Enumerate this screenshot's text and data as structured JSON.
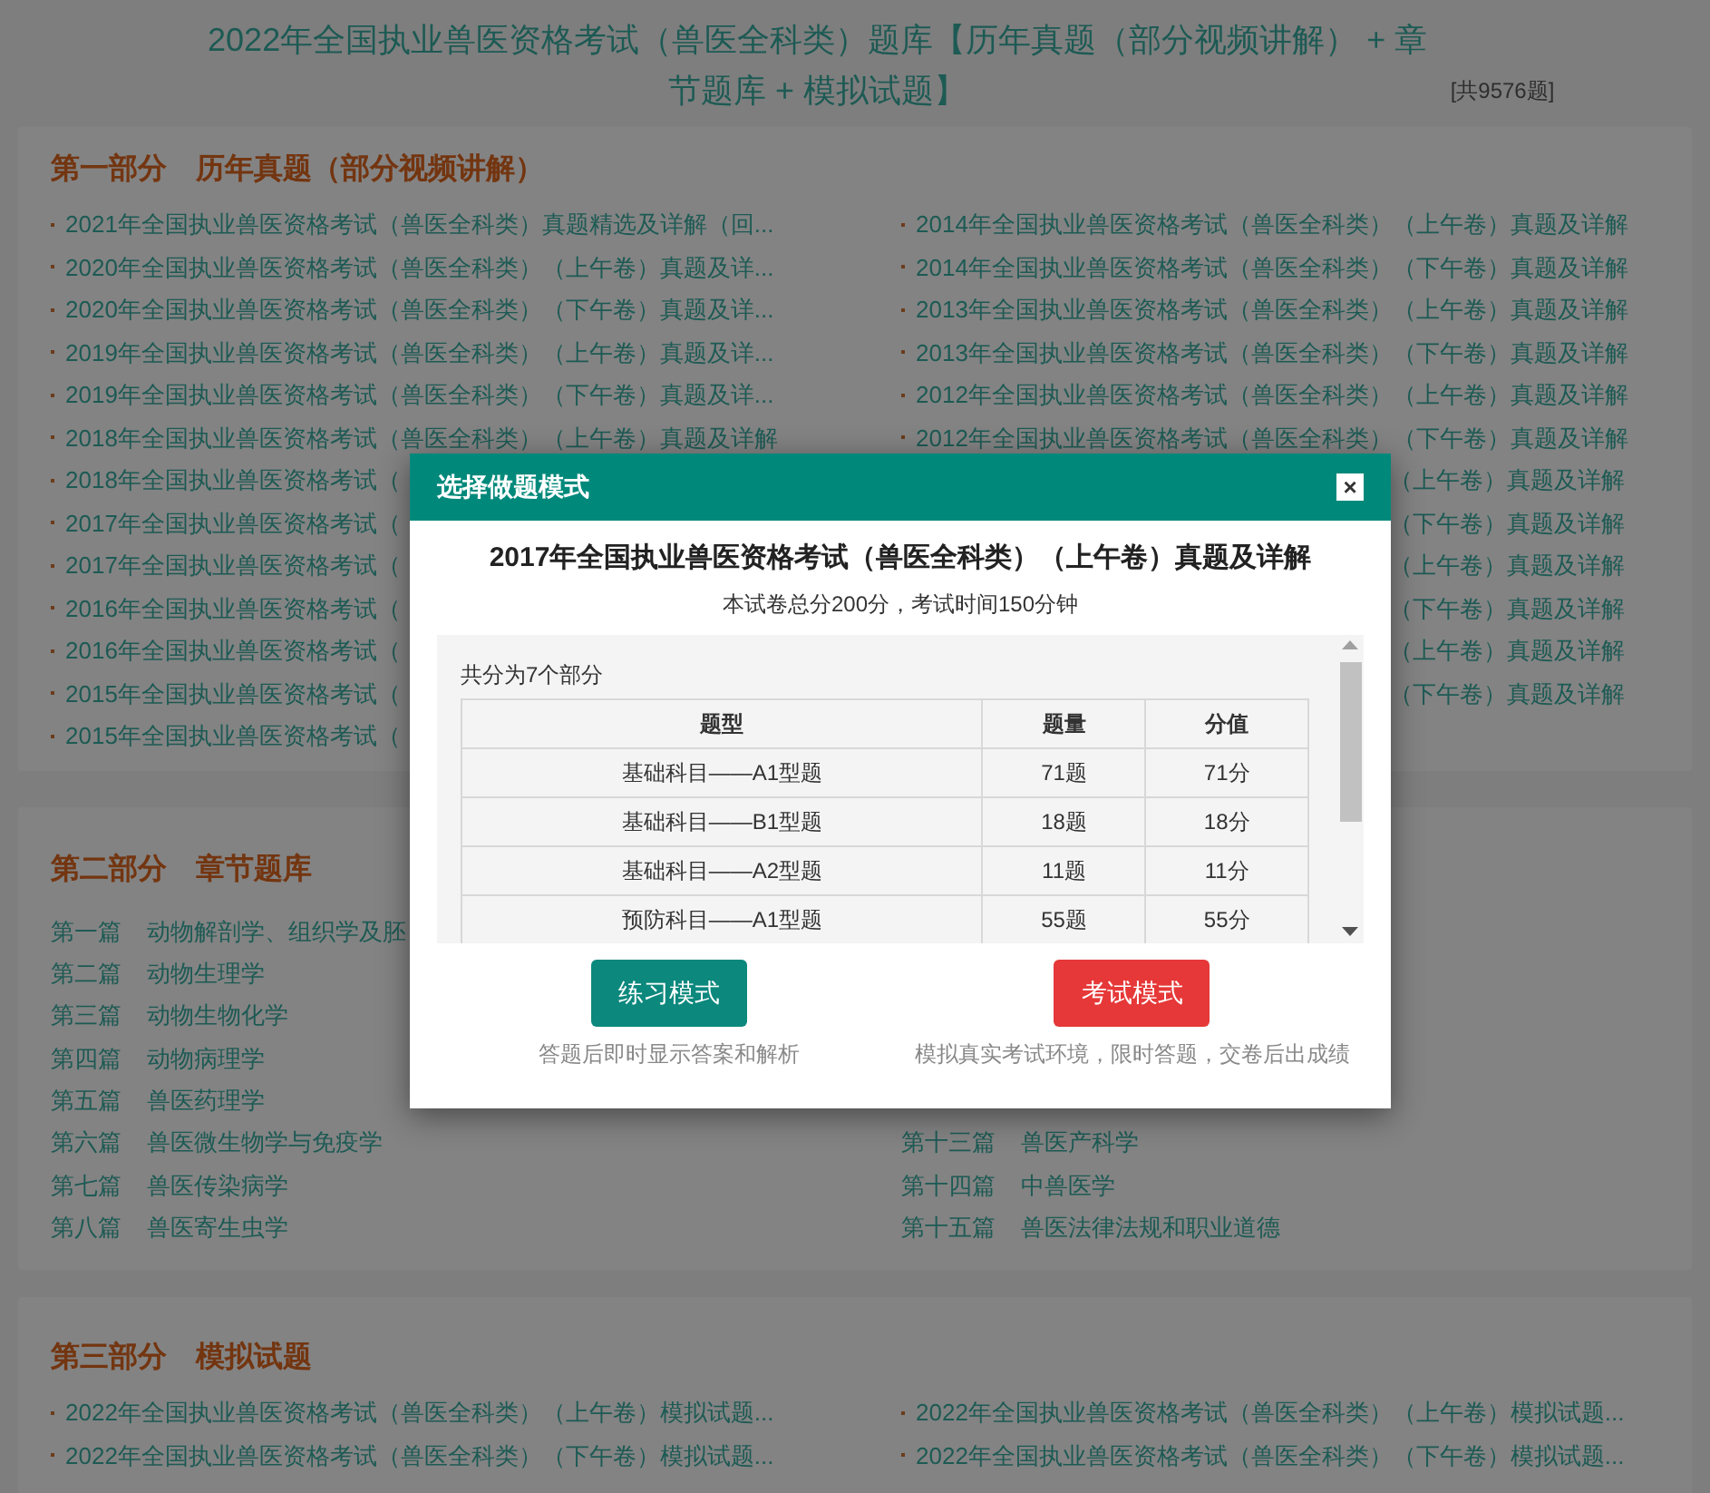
{
  "page_title": "2022年全国执业兽医资格考试（兽医全科类）题库【历年真题（部分视频讲解） + 章节题库 + 模拟试题】",
  "question_count": "[共9576题]",
  "sections": [
    {
      "kind": "papers",
      "title": "第一部分　历年真题（部分视频讲解）",
      "left": [
        {
          "kind": "full",
          "text": "2021年全国执业兽医资格考试（兽医全科类）真题精选及详解（回..."
        },
        {
          "kind": "full",
          "text": "2020年全国执业兽医资格考试（兽医全科类）（上午卷）真题及详..."
        },
        {
          "kind": "full",
          "text": "2020年全国执业兽医资格考试（兽医全科类）（下午卷）真题及详..."
        },
        {
          "kind": "full",
          "text": "2019年全国执业兽医资格考试（兽医全科类）（上午卷）真题及详..."
        },
        {
          "kind": "full",
          "text": "2019年全国执业兽医资格考试（兽医全科类）（下午卷）真题及详..."
        },
        {
          "kind": "full",
          "text": "2018年全国执业兽医资格考试（兽医全科类）（上午卷）真题及详解"
        },
        {
          "kind": "full",
          "text": "2018年全国执业兽医资格考试（"
        },
        {
          "kind": "full",
          "text": "2017年全国执业兽医资格考试（"
        },
        {
          "kind": "full",
          "text": "2017年全国执业兽医资格考试（"
        },
        {
          "kind": "full",
          "text": "2016年全国执业兽医资格考试（"
        },
        {
          "kind": "full",
          "text": "2016年全国执业兽医资格考试（"
        },
        {
          "kind": "full",
          "text": "2015年全国执业兽医资格考试（"
        },
        {
          "kind": "full",
          "text": "2015年全国执业兽医资格考试（"
        }
      ],
      "right": [
        {
          "kind": "full",
          "text": "2014年全国执业兽医资格考试（兽医全科类）（上午卷）真题及详解"
        },
        {
          "kind": "full",
          "text": "2014年全国执业兽医资格考试（兽医全科类）（下午卷）真题及详解"
        },
        {
          "kind": "full",
          "text": "2013年全国执业兽医资格考试（兽医全科类）（上午卷）真题及详解"
        },
        {
          "kind": "full",
          "text": "2013年全国执业兽医资格考试（兽医全科类）（下午卷）真题及详解"
        },
        {
          "kind": "full",
          "text": "2012年全国执业兽医资格考试（兽医全科类）（上午卷）真题及详解"
        },
        {
          "kind": "full",
          "text": "2012年全国执业兽医资格考试（兽医全科类）（下午卷）真题及详解"
        },
        {
          "kind": "partial",
          "text": "（上午卷）真题及详解"
        },
        {
          "kind": "partial",
          "text": "（下午卷）真题及详解"
        },
        {
          "kind": "partial",
          "text": "（上午卷）真题及详解"
        },
        {
          "kind": "partial",
          "text": "（下午卷）真题及详解"
        },
        {
          "kind": "partial",
          "text": "（上午卷）真题及详解"
        },
        {
          "kind": "partial",
          "text": "（下午卷）真题及详解"
        }
      ]
    },
    {
      "kind": "chapters",
      "title": "第二部分　章节题库",
      "left": [
        {
          "number": "第一篇",
          "name": "动物解剖学、组织学及胚"
        },
        {
          "number": "第二篇",
          "name": "动物生理学"
        },
        {
          "number": "第三篇",
          "name": "动物生物化学"
        },
        {
          "number": "第四篇",
          "name": "动物病理学"
        },
        {
          "number": "第五篇",
          "name": "兽医药理学"
        },
        {
          "number": "第六篇",
          "name": "兽医微生物学与免疫学"
        },
        {
          "number": "第七篇",
          "name": "兽医传染病学"
        },
        {
          "number": "第八篇",
          "name": "兽医寄生虫学"
        }
      ],
      "right": [
        {
          "number": "第十三篇",
          "name": "兽医产科学"
        },
        {
          "number": "第十四篇",
          "name": "中兽医学"
        },
        {
          "number": "第十五篇",
          "name": "兽医法律法规和职业道德"
        }
      ]
    },
    {
      "kind": "papers",
      "title": "第三部分　模拟试题",
      "left": [
        {
          "kind": "full",
          "text": "2022年全国执业兽医资格考试（兽医全科类）（上午卷）模拟试题..."
        },
        {
          "kind": "full",
          "text": "2022年全国执业兽医资格考试（兽医全科类）（下午卷）模拟试题..."
        }
      ],
      "right": [
        {
          "kind": "full",
          "text": "2022年全国执业兽医资格考试（兽医全科类）（上午卷）模拟试题..."
        },
        {
          "kind": "full",
          "text": "2022年全国执业兽医资格考试（兽医全科类）（下午卷）模拟试题..."
        }
      ]
    }
  ],
  "dialog": {
    "title": "选择做题模式",
    "close": "×",
    "paper_title": "2017年全国执业兽医资格考试（兽医全科类）（上午卷）真题及详解",
    "summary": "本试卷总分200分，考试时间150分钟",
    "parts_note": "共分为7个部分",
    "table": {
      "columns": [
        "题型",
        "题量",
        "分值"
      ],
      "rows": [
        [
          "基础科目——A1型题",
          "71题",
          "71分"
        ],
        [
          "基础科目——B1型题",
          "18题",
          "18分"
        ],
        [
          "基础科目——A2型题",
          "11题",
          "11分"
        ],
        [
          "预防科目——A1型题",
          "55题",
          "55分"
        ]
      ]
    },
    "modes": [
      {
        "kind": "practice",
        "label": "练习模式",
        "caption": "答题后即时显示答案和解析"
      },
      {
        "kind": "exam",
        "label": "考试模式",
        "caption": "模拟真实考试环境，限时答题，交卷后出成绩"
      }
    ]
  }
}
